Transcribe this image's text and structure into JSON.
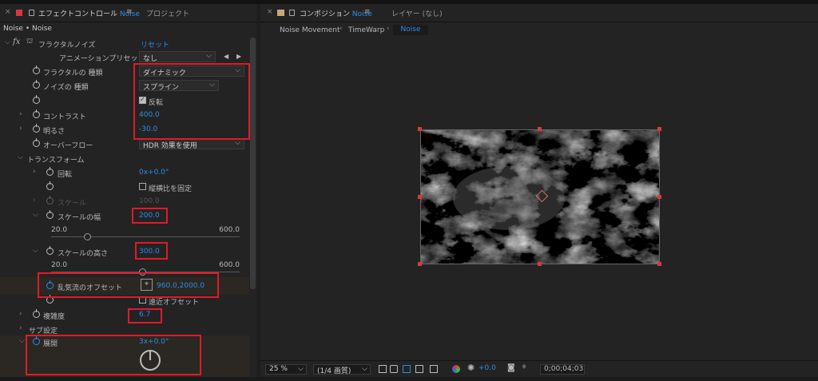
{
  "effect_panel": {
    "tab_title": "エフェクトコントロール",
    "tab_layer": "Noise",
    "project_tab": "プロジェクト",
    "breadcrumb": "Noise • Noise",
    "effect_name": "フラクタルノイズ",
    "reset_label": "リセット",
    "preset_label": "アニメーションプリセット",
    "preset_value": "なし",
    "fractal_type_label": "フラクタルの 種類",
    "fractal_type_value": "ダイナミック",
    "noise_type_label": "ノイズの 種類",
    "noise_type_value": "スプライン",
    "invert_label": "反転",
    "invert_checked": true,
    "contrast_label": "コントラスト",
    "contrast_value": "400.0",
    "brightness_label": "明るさ",
    "brightness_value": "-30.0",
    "overflow_label": "オーバーフロー",
    "overflow_value": "HDR 効果を使用",
    "transform_label": "トランスフォーム",
    "rotation_label": "回転",
    "rotation_value": "0x+0.0°",
    "uniform_scaling_label": "縦横比を固定",
    "uniform_scaling_checked": false,
    "scale_label": "スケール",
    "scale_value": "100.0",
    "scale_width_label": "スケールの幅",
    "scale_width_value": "200.0",
    "scale_width_slider": {
      "min": "20.0",
      "max": "600.0",
      "level": 0.18
    },
    "scale_height_label": "スケールの高さ",
    "scale_height_value": "300.0",
    "scale_height_slider": {
      "min": "20.0",
      "max": "600.0",
      "level": 0.48
    },
    "turbulence_offset_label": "乱気流のオフセット",
    "turbulence_offset_value": "960.0,2000.0",
    "perspective_offset_label": "遠近オフセット",
    "complexity_label": "複雑度",
    "complexity_value": "6.7",
    "sub_settings_label": "サブ設定",
    "evolution_label": "展開",
    "evolution_value": "3x+0.0°"
  },
  "comp_panel": {
    "tab_label": "コンポジション",
    "tab_comp": "Noise",
    "layer_tab": "レイヤー (なし)",
    "nav": [
      "Noise Movement",
      "TimeWarp",
      "Noise"
    ],
    "zoom": "25 %",
    "resolution": "(1/4 画質)",
    "exposure": "+0.0",
    "timecode": "0;00;04;03"
  },
  "colors": {
    "accent": "#2d8ceb",
    "highlight": "#e01a2a"
  }
}
